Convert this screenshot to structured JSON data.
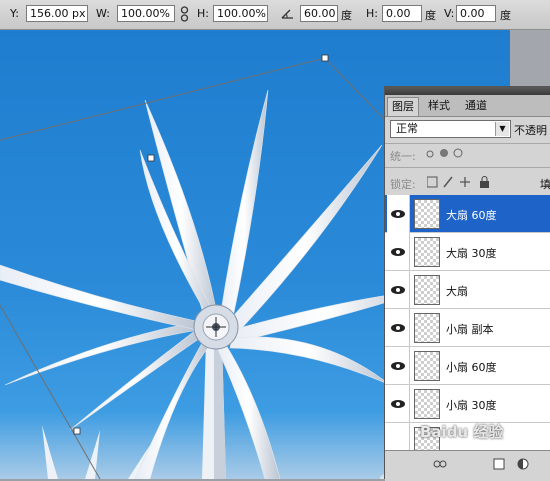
{
  "options_bar": {
    "y_label": "Y:",
    "y_value": "156.00 px",
    "w_label": "W:",
    "w_value": "100.00%",
    "h_label": "H:",
    "h_value": "100.00%",
    "angle_value": "60.00",
    "angle_unit": "度",
    "hskew_label": "H:",
    "hskew_value": "0.00",
    "hskew_unit": "度",
    "vskew_label": "V:",
    "vskew_value": "0.00",
    "vskew_unit": "度",
    "icons": [
      "link-icon",
      "angle-icon"
    ]
  },
  "layers_panel": {
    "tabs": [
      {
        "label": "图层",
        "active": true
      },
      {
        "label": "样式",
        "active": false
      },
      {
        "label": "通道",
        "active": false
      }
    ],
    "blend_mode": "正常",
    "opacity_label": "不透明",
    "unify_label": "统一:",
    "lock_label": "锁定:",
    "fill_label": "填",
    "layers": [
      {
        "name": "大扇 60度",
        "selected": true
      },
      {
        "name": "大扇 30度",
        "selected": false
      },
      {
        "name": "大扇",
        "selected": false
      },
      {
        "name": "小扇 副本",
        "selected": false
      },
      {
        "name": "小扇 60度",
        "selected": false
      },
      {
        "name": "小扇 30度",
        "selected": false
      }
    ]
  },
  "watermark": "Baidu 经验",
  "colors": {
    "sky": "#2a8ad8",
    "selection": "#1e64c8",
    "panel": "#d4d4d4"
  }
}
